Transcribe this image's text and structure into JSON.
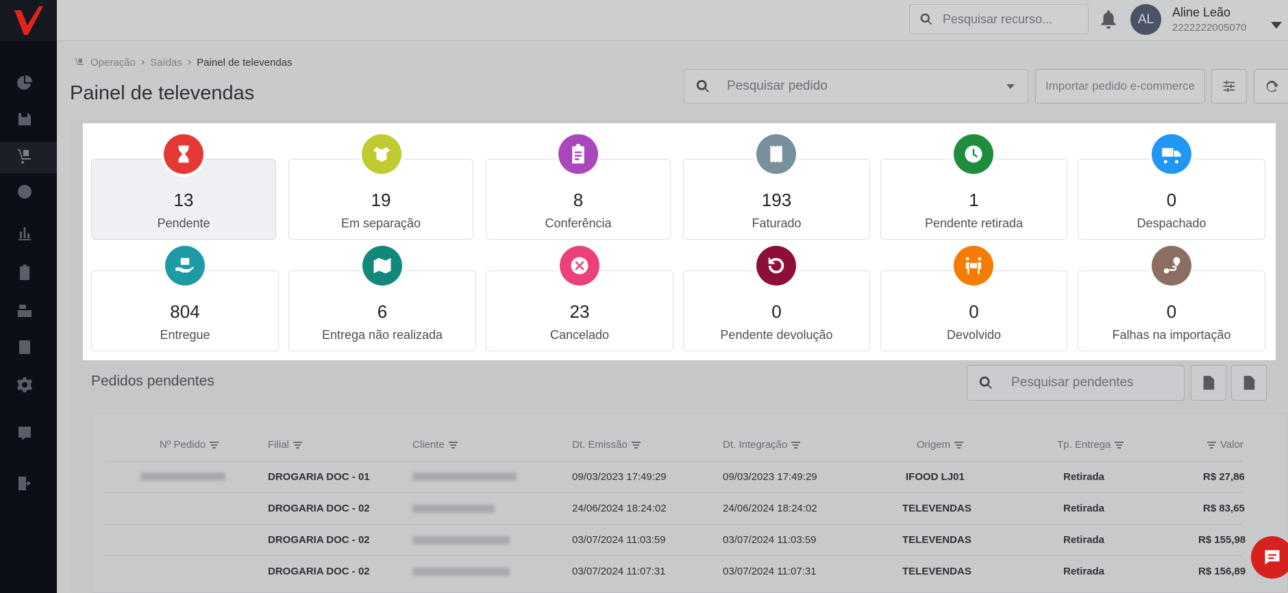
{
  "header": {
    "search_placeholder": "Pesquisar recurso...",
    "user": {
      "initials": "AL",
      "name": "Aline Leão",
      "id": "2222222005070"
    }
  },
  "breadcrumb": [
    "Operação",
    "Saídas",
    "Painel de televendas"
  ],
  "page": {
    "title": "Painel de televendas",
    "order_search_placeholder": "Pesquisar pedido",
    "import_button": "Importar pedido e-commerce"
  },
  "statuses": [
    {
      "value": "13",
      "label": "Pendente",
      "color": "#e53935",
      "icon": "hourglass-icon"
    },
    {
      "value": "19",
      "label": "Em separação",
      "color": "#c0ca33",
      "icon": "open-box-icon"
    },
    {
      "value": "8",
      "label": "Conferência",
      "color": "#ab47bc",
      "icon": "clipboard-icon"
    },
    {
      "value": "193",
      "label": "Faturado",
      "color": "#78909c",
      "icon": "receipt-icon"
    },
    {
      "value": "1",
      "label": "Pendente retirada",
      "color": "#1e8e3e",
      "icon": "clock-icon"
    },
    {
      "value": "0",
      "label": "Despachado",
      "color": "#2196f3",
      "icon": "truck-icon"
    },
    {
      "value": "804",
      "label": "Entregue",
      "color": "#1e9aa5",
      "icon": "hand-box-icon"
    },
    {
      "value": "6",
      "label": "Entrega não realizada",
      "color": "#11887a",
      "icon": "map-pin-icon"
    },
    {
      "value": "23",
      "label": "Cancelado",
      "color": "#ec407a",
      "icon": "cancel-icon"
    },
    {
      "value": "0",
      "label": "Pendente devolução",
      "color": "#8e0e3a",
      "icon": "undo-icon"
    },
    {
      "value": "0",
      "label": "Devolvido",
      "color": "#f57c00",
      "icon": "people-carry-icon"
    },
    {
      "value": "0",
      "label": "Falhas na importação",
      "color": "#8d6e63",
      "icon": "route-icon"
    }
  ],
  "pending": {
    "title": "Pedidos pendentes",
    "search_placeholder": "Pesquisar pendentes",
    "columns": [
      "Nº Pedido",
      "Filial",
      "Cliente",
      "Dt. Emissão",
      "Dt. Integração",
      "Origem",
      "Tp. Entrega",
      "Valor"
    ],
    "rows": [
      {
        "filial": "DROGARIA DOC - 01",
        "emissao": "09/03/2023 17:49:29",
        "integracao": "09/03/2023 17:49:29",
        "origem": "IFOOD LJ01",
        "entrega": "Retirada",
        "valor": "R$ 27,86"
      },
      {
        "filial": "DROGARIA DOC - 02",
        "emissao": "24/06/2024 18:24:02",
        "integracao": "24/06/2024 18:24:02",
        "origem": "TELEVENDAS",
        "entrega": "Retirada",
        "valor": "R$ 83,65"
      },
      {
        "filial": "DROGARIA DOC - 02",
        "emissao": "03/07/2024 11:03:59",
        "integracao": "03/07/2024 11:03:59",
        "origem": "TELEVENDAS",
        "entrega": "Retirada",
        "valor": "R$ 155,98"
      },
      {
        "filial": "DROGARIA DOC - 02",
        "emissao": "03/07/2024 11:07:31",
        "integracao": "03/07/2024 11:07:31",
        "origem": "TELEVENDAS",
        "entrega": "Retirada",
        "valor": "R$ 156,89"
      }
    ]
  }
}
